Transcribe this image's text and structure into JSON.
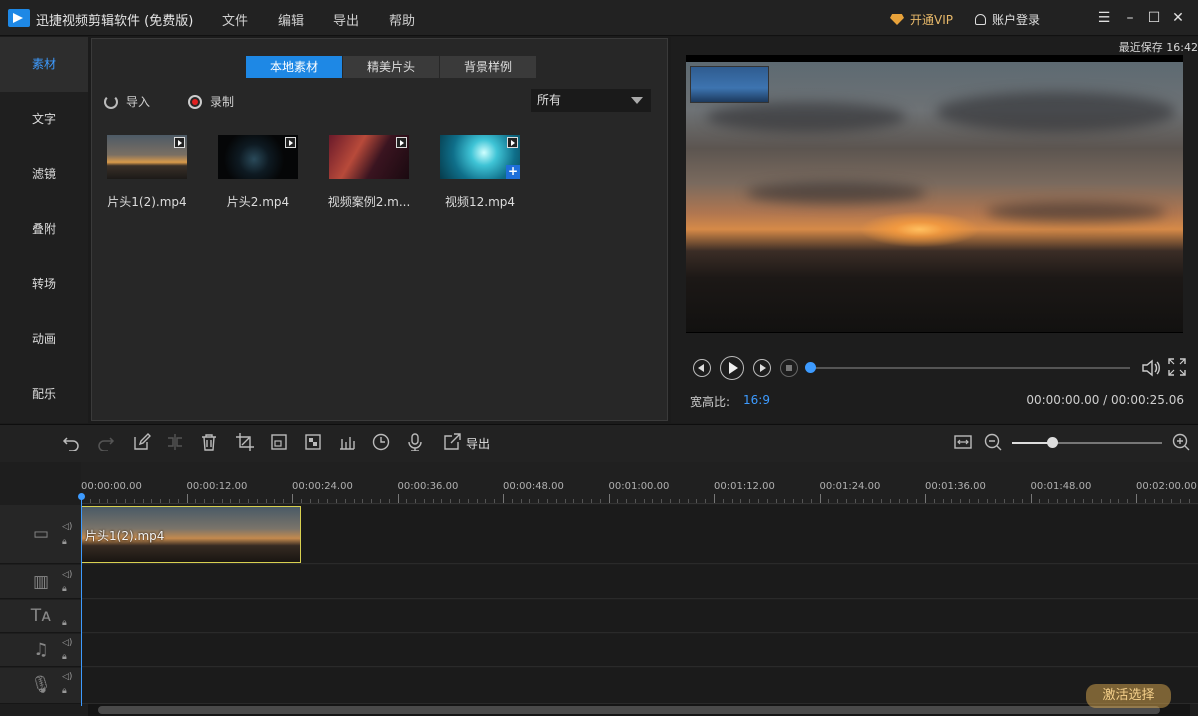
{
  "titlebar": {
    "app_title": "迅捷视频剪辑软件 (免费版)",
    "menu": [
      "文件",
      "编辑",
      "导出",
      "帮助"
    ],
    "vip_label": "开通VIP",
    "login_label": "账户登录",
    "window_controls": [
      "menu-icon",
      "minimize-icon",
      "maximize-icon",
      "close-icon"
    ]
  },
  "sidebar": {
    "items": [
      {
        "label": "素材",
        "active": true
      },
      {
        "label": "文字"
      },
      {
        "label": "滤镜"
      },
      {
        "label": "叠附"
      },
      {
        "label": "转场"
      },
      {
        "label": "动画"
      },
      {
        "label": "配乐"
      }
    ]
  },
  "material": {
    "tabs": [
      {
        "label": "本地素材",
        "active": true
      },
      {
        "label": "精美片头"
      },
      {
        "label": "背景样例"
      }
    ],
    "import_label": "导入",
    "record_label": "录制",
    "filter_value": "所有",
    "items": [
      {
        "name": "片头1(2).mp4"
      },
      {
        "name": "片头2.mp4"
      },
      {
        "name": "视频案例2.m..."
      },
      {
        "name": "视频12.mp4",
        "added": true
      }
    ]
  },
  "preview": {
    "last_save": "最近保存 16:42",
    "aspect_label": "宽高比:",
    "aspect_value": "16:9",
    "current_time": "00:00:00.00",
    "total_time": "00:00:25.06",
    "time_readout": "00:00:00.00 / 00:00:25.06",
    "progress": 0
  },
  "toolbar": {
    "tools": [
      "undo-icon",
      "redo-icon",
      "edit-icon",
      "split-icon",
      "delete-icon",
      "crop-icon",
      "resize-icon",
      "mosaic-icon",
      "audio-levels-icon",
      "clock-icon",
      "mic-icon",
      "export-icon"
    ],
    "export_label": "导出",
    "zoom_level": 0.27
  },
  "timeline": {
    "ticks": [
      "00:00:00.00",
      "00:00:12.00",
      "00:00:24.00",
      "00:00:36.00",
      "00:00:48.00",
      "00:01:00.00",
      "00:01:12.00",
      "00:01:24.00",
      "00:01:36.00",
      "00:01:48.00",
      "00:02:00.00"
    ],
    "tracks": [
      "video-track-icon",
      "overlay-track-icon",
      "text-track-icon",
      "music-track-icon",
      "voice-track-icon"
    ],
    "clip_label": "片头1(2).mp4"
  },
  "watermark": "激活选择",
  "colors": {
    "accent": "#1e88e5",
    "highlight": "#3d9bff",
    "vip": "#e8b96a",
    "clip_border": "#d8d050"
  }
}
